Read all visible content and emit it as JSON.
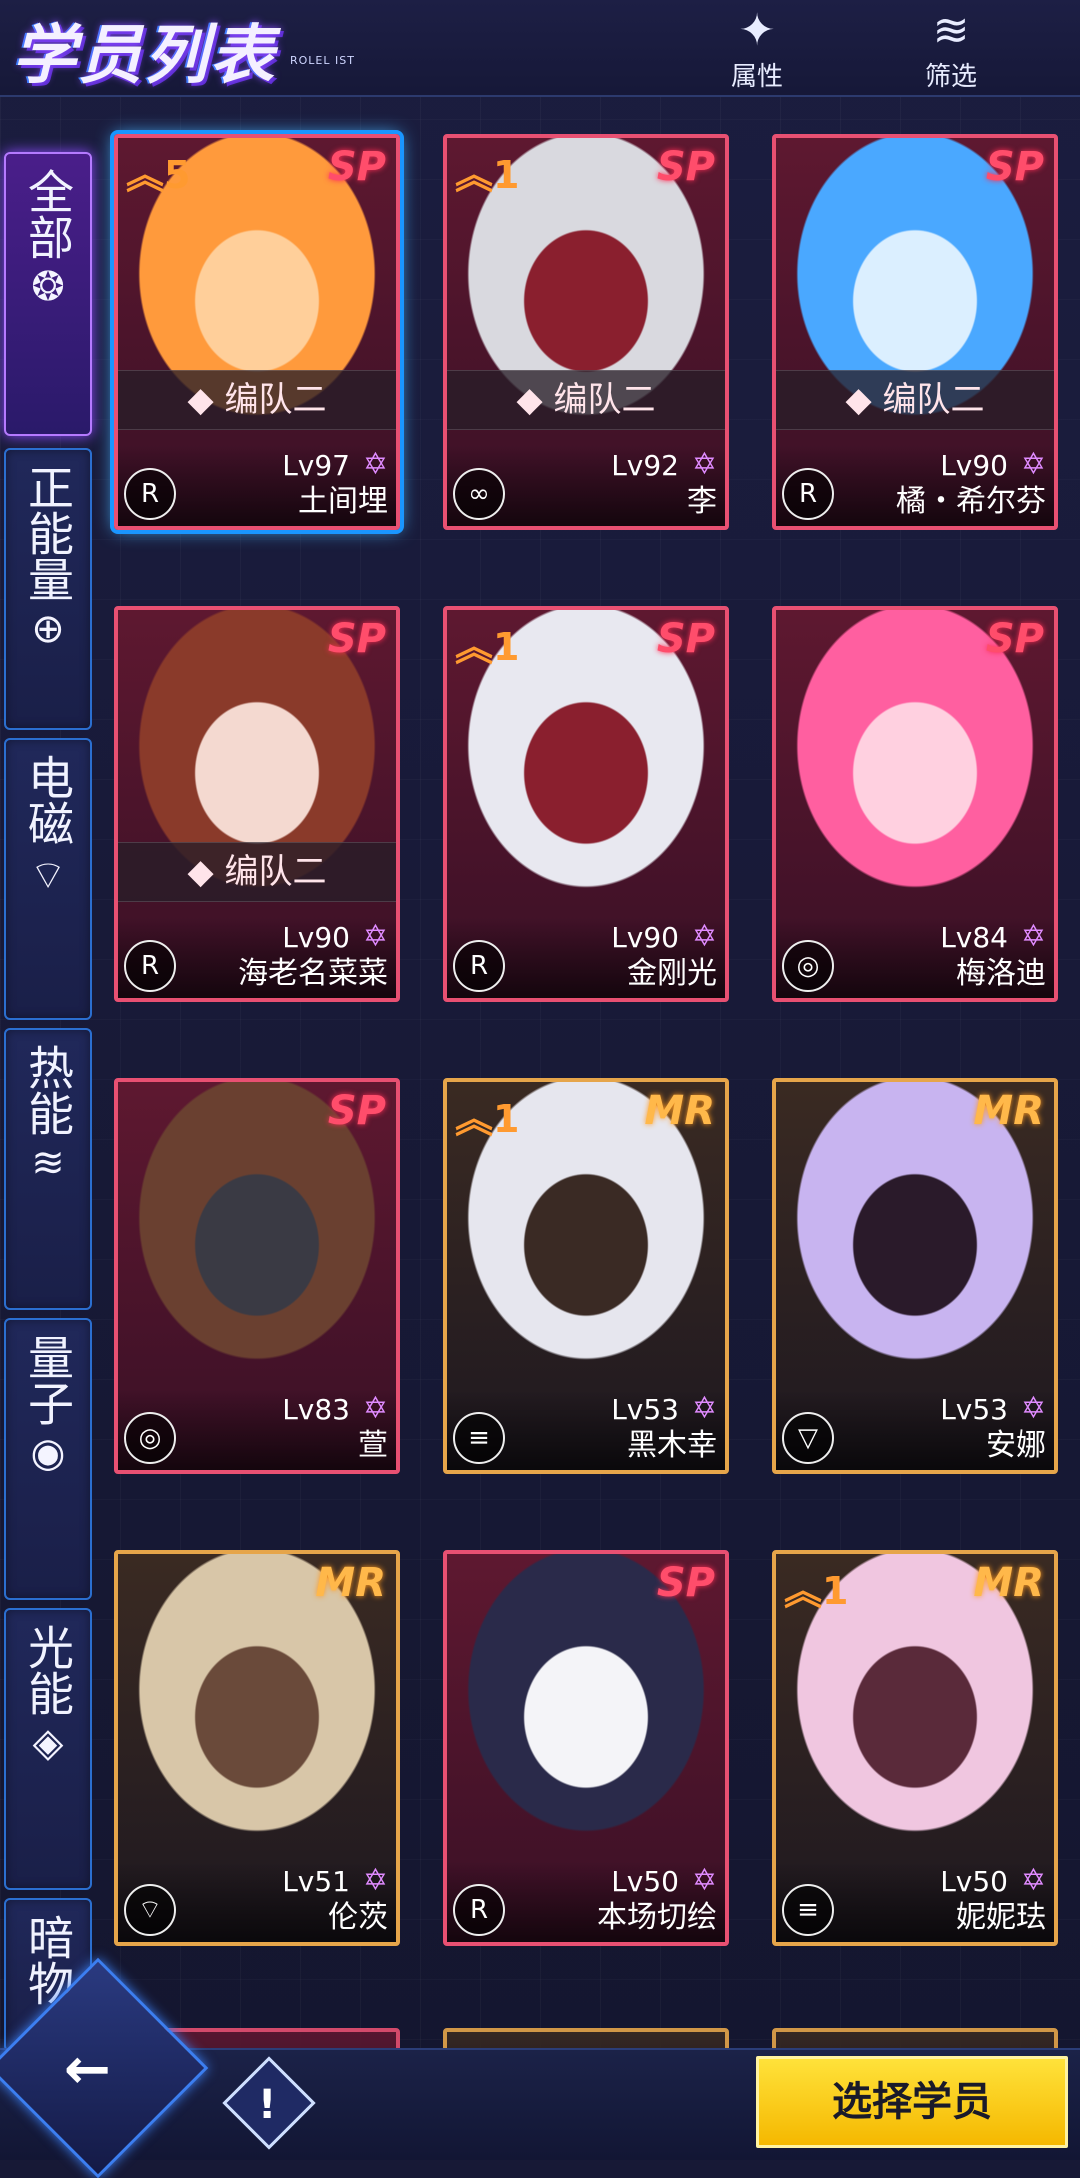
{
  "header": {
    "title": "学员列表",
    "subtitle": "ROLEL IST",
    "attr_button_label": "属性",
    "filter_button_label": "筛选"
  },
  "sidebar": {
    "tabs": [
      {
        "label": "全部",
        "icon": "all-icon"
      },
      {
        "label": "正能量",
        "icon": "positive-energy-icon"
      },
      {
        "label": "电磁",
        "icon": "wifi-icon"
      },
      {
        "label": "热能",
        "icon": "heat-icon"
      },
      {
        "label": "量子",
        "icon": "quantum-icon"
      },
      {
        "label": "光能",
        "icon": "light-icon"
      },
      {
        "label": "暗物",
        "icon": "dark-icon"
      }
    ]
  },
  "cards": [
    {
      "rank": "SP",
      "stars": "5",
      "team": "编队二",
      "level": "Lv97",
      "name": "土间埋",
      "attr": "R"
    },
    {
      "rank": "SP",
      "stars": "1",
      "team": "编队二",
      "level": "Lv92",
      "name": "李",
      "attr": "∞"
    },
    {
      "rank": "SP",
      "stars": "",
      "team": "编队二",
      "level": "Lv90",
      "name": "橘・希尔芬",
      "attr": "R"
    },
    {
      "rank": "SP",
      "stars": "",
      "team": "编队二",
      "level": "Lv90",
      "name": "海老名菜菜",
      "attr": "R"
    },
    {
      "rank": "SP",
      "stars": "1",
      "team": "",
      "level": "Lv90",
      "name": "金刚光",
      "attr": "R"
    },
    {
      "rank": "SP",
      "stars": "",
      "team": "",
      "level": "Lv84",
      "name": "梅洛迪",
      "attr": "◎"
    },
    {
      "rank": "SP",
      "stars": "",
      "team": "",
      "level": "Lv83",
      "name": "萱",
      "attr": "◎"
    },
    {
      "rank": "MR",
      "stars": "1",
      "team": "",
      "level": "Lv53",
      "name": "黑木幸",
      "attr": "≡"
    },
    {
      "rank": "MR",
      "stars": "",
      "team": "",
      "level": "Lv53",
      "name": "安娜",
      "attr": "▽"
    },
    {
      "rank": "MR",
      "stars": "",
      "team": "",
      "level": "Lv51",
      "name": "伦茨",
      "attr": "⌔"
    },
    {
      "rank": "SP",
      "stars": "",
      "team": "",
      "level": "Lv50",
      "name": "本场切绘",
      "attr": "R"
    },
    {
      "rank": "MR",
      "stars": "1",
      "team": "",
      "level": "Lv50",
      "name": "妮妮珐",
      "attr": "≡"
    }
  ],
  "footer": {
    "back_label": "←",
    "info_label": "!",
    "select_button_label": "选择学员"
  },
  "colors": {
    "sp_border": "#e85072",
    "mr_border": "#e6a54a",
    "accent_blue": "#2b6fd0",
    "select_yellow": "#ffd21a"
  }
}
